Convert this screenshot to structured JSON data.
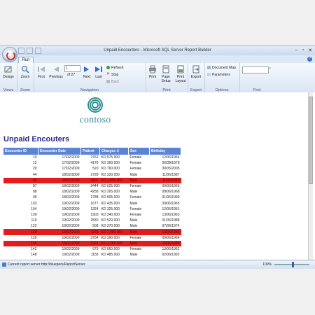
{
  "window": {
    "title": "Unpaid Encounters - Microsoft SQL Server Report Builder"
  },
  "ribbon": {
    "tab_run": "Run",
    "views": {
      "design": "Design",
      "label": "Views"
    },
    "zoom": {
      "zoom": "Zoom",
      "label": "Zoom"
    },
    "navigation": {
      "first": "First",
      "previous": "Previous",
      "page_value": "1",
      "of_pages": "of  27",
      "next": "Next",
      "last": "Last",
      "refresh": "Refresh",
      "stop": "Stop",
      "back": "Back",
      "label": "Navigation"
    },
    "print": {
      "print": "Print",
      "page_setup": "Page Setup",
      "print_layout": "Print Layout",
      "label": "Print"
    },
    "export": {
      "export": "Export",
      "label": "Export"
    },
    "options": {
      "document_map": "Document Map",
      "parameters": "Parameters",
      "label": "Options"
    },
    "find": {
      "label": "Find"
    }
  },
  "report": {
    "logo": "contoso",
    "title": "Unpaid Encouters",
    "columns": [
      "Encounter ID",
      "Encounter Date",
      "Patient",
      "Charges",
      "Sex",
      "Birthday"
    ],
    "rows": [
      {
        "id": "10",
        "date": "17/02/2009",
        "patient": "2762",
        "charges": "KD 575.000",
        "sex": "Female",
        "birthday": "12/06/1954",
        "red": false
      },
      {
        "id": "12",
        "date": "17/02/2009",
        "patient": "4178",
        "charges": "KD 360.000",
        "sex": "Female",
        "birthday": "06/08/1978",
        "red": false
      },
      {
        "id": "20",
        "date": "17/02/2009",
        "patient": "520",
        "charges": "KD 760.000",
        "sex": "Female",
        "birthday": "30/05/2005",
        "red": false
      },
      {
        "id": "44",
        "date": "18/02/2009",
        "patient": "2728",
        "charges": "KD 220.000",
        "sex": "Male",
        "birthday": "11/06/1987",
        "red": false
      },
      {
        "id": "85",
        "date": "18/02/2009",
        "patient": "2607",
        "charges": "KD 1,050.000",
        "sex": "Male",
        "birthday": "11/06/1959",
        "red": true
      },
      {
        "id": "87",
        "date": "18/02/2009",
        "patient": "2444",
        "charges": "KD 025.000",
        "sex": "Female",
        "birthday": "09/06/1965",
        "red": false
      },
      {
        "id": "88",
        "date": "18/02/2009",
        "patient": "4258",
        "charges": "KD 265.000",
        "sex": "Male",
        "birthday": "08/06/1968",
        "red": false
      },
      {
        "id": "96",
        "date": "18/02/2009",
        "patient": "1788",
        "charges": "KD 605.000",
        "sex": "Female",
        "birthday": "01/06/1999",
        "red": false
      },
      {
        "id": "103",
        "date": "19/02/2009",
        "patient": "1677",
        "charges": "KD 435.000",
        "sex": "Male",
        "birthday": "09/06/1965",
        "red": false
      },
      {
        "id": "104",
        "date": "19/02/2009",
        "patient": "1324",
        "charges": "KD 325.000",
        "sex": "Female",
        "birthday": "12/06/1951",
        "red": false
      },
      {
        "id": "109",
        "date": "19/02/2009",
        "patient": "1903",
        "charges": "KD 340.000",
        "sex": "Female",
        "birthday": "13/06/1963",
        "red": false
      },
      {
        "id": "110",
        "date": "19/02/2009",
        "patient": "2830",
        "charges": "KD 520.000",
        "sex": "Male",
        "birthday": "01/06/1988",
        "red": false
      },
      {
        "id": "122",
        "date": "19/02/2009",
        "patient": "508",
        "charges": "KD 370.000",
        "sex": "Male",
        "birthday": "07/06/1974",
        "red": false
      },
      {
        "id": "128",
        "date": "19/02/2009",
        "patient": "3218",
        "charges": "KD 1,080.000",
        "sex": "Male",
        "birthday": "16/06/1969",
        "red": true
      },
      {
        "id": "129",
        "date": "19/02/2009",
        "patient": "3754",
        "charges": "KD 390.000",
        "sex": "Female",
        "birthday": "09/06/1964",
        "red": false
      },
      {
        "id": "135",
        "date": "19/02/2009",
        "patient": "3291",
        "charges": "KD 1,265.000",
        "sex": "Male",
        "birthday": "18/06/1984",
        "red": true
      },
      {
        "id": "142",
        "date": "19/02/2009",
        "patient": "679",
        "charges": "KD 660.000",
        "sex": "Female",
        "birthday": "13/06/1962",
        "red": false
      },
      {
        "id": "148",
        "date": "19/02/2009",
        "patient": "1158",
        "charges": "KD 485.000",
        "sex": "Male",
        "birthday": "02/06/1992",
        "red": false
      }
    ]
  },
  "status": {
    "text": "Current report server http://bluepers/ReportServer",
    "zoom": "100%"
  }
}
